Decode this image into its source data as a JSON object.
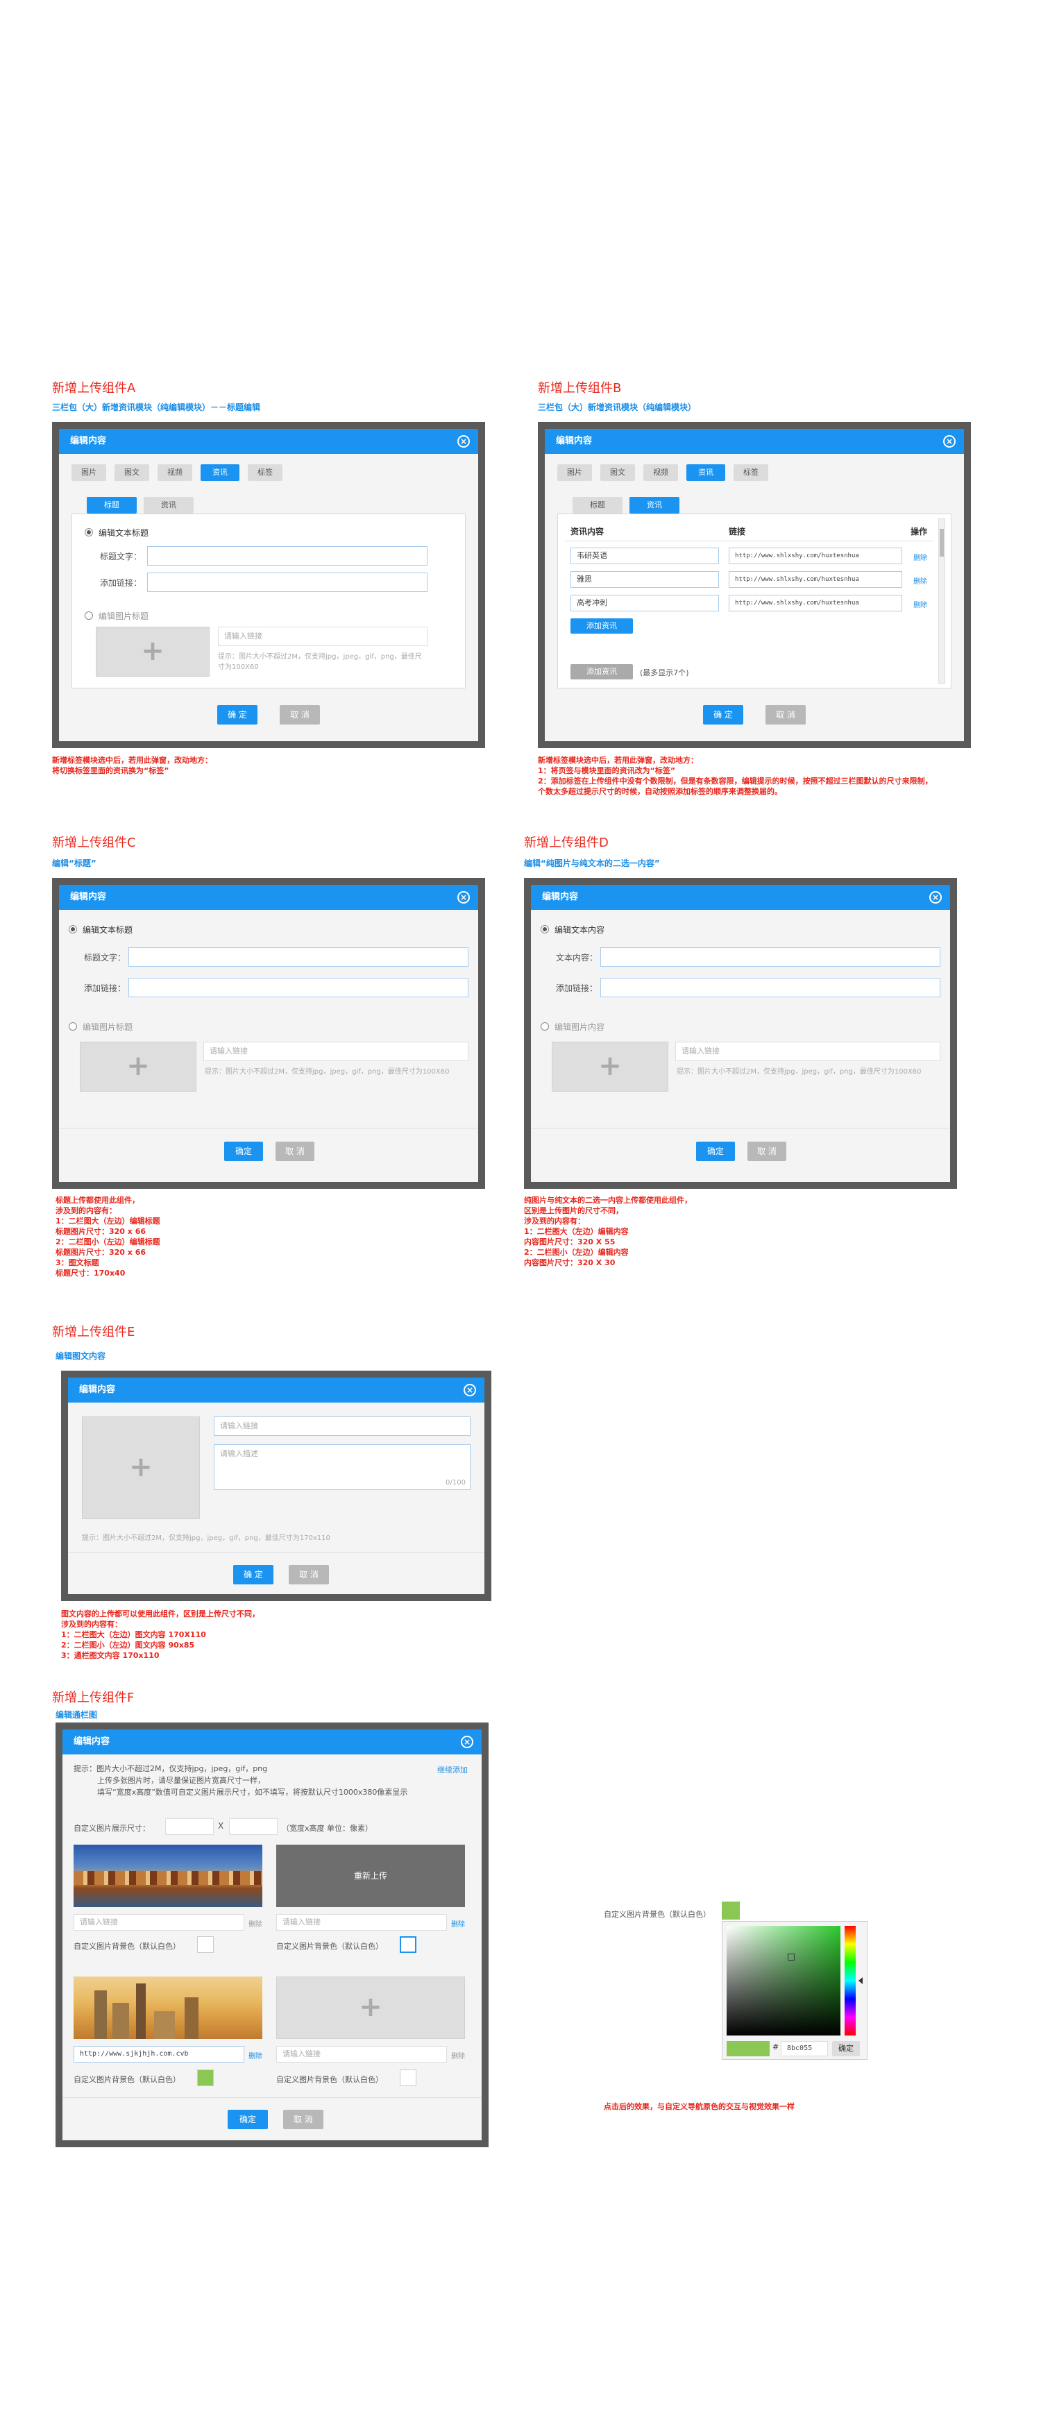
{
  "common": {
    "dialog_title": "编辑内容",
    "ok": "确 定",
    "cancel": "取 消",
    "ok_short": "确定",
    "cancel_short": "取 消"
  },
  "A": {
    "title": "新增上传组件A",
    "subtitle": "三栏包（大）新增资讯模块（纯编辑模块）－－标题编辑",
    "top_tabs": [
      "图片",
      "图文",
      "视频",
      "资讯",
      "标签"
    ],
    "sub_tabs": [
      "标题",
      "资讯"
    ],
    "text_radio": "编辑文本标题",
    "title_label": "标题文字：",
    "link_label": "添加链接：",
    "img_radio": "编辑图片标题",
    "link_placeholder": "请输入链接",
    "hint": "提示：图片大小不超过2M，仅支持jpg，jpeg，gif，png，最佳尺寸为100X60",
    "notes": [
      "新增标签模块选中后，若用此弹窗，改动地方：",
      "将切换标签里面的资讯换为“标签”"
    ]
  },
  "B": {
    "title": "新增上传组件B",
    "subtitle": "三栏包（大）新增资讯模块（纯编辑模块）",
    "top_tabs": [
      "图片",
      "图文",
      "视频",
      "资讯",
      "标签"
    ],
    "sub_tabs": [
      "标题",
      "资讯"
    ],
    "col_content": "资讯内容",
    "col_link": "链接",
    "col_op": "操作",
    "rows": [
      {
        "content": "韦研英语",
        "link": "http://www.shlxshy.com/huxtesnhua",
        "op": "删除"
      },
      {
        "content": "雅思",
        "link": "http://www.shlxshy.com/huxtesnhua",
        "op": "删除"
      },
      {
        "content": "高考冲刺",
        "link": "http://www.shlxshy.com/huxtesnhua",
        "op": "删除"
      }
    ],
    "add_label": "添加资讯",
    "add_label_disabled": "添加资讯",
    "max_note": "(最多显示7个)",
    "notes": [
      "新增标签模块选中后，若用此弹窗，改动地方：",
      "1：将页签与模块里面的资讯改为“标签”",
      "2：添加标签在上传组件中没有个数限制，但是有条数容限，编辑提示的时候，按照不超过三栏图默认的尺寸来限制，",
      "个数太多超过提示尺寸的时候，自动按照添加标签的顺序来调整换届的。"
    ]
  },
  "C": {
    "title": "新增上传组件C",
    "subtitle": "编辑“标题”",
    "text_radio": "编辑文本标题",
    "title_label": "标题文字：",
    "link_label": "添加链接：",
    "img_radio": "编辑图片标题",
    "link_placeholder": "请输入链接",
    "hint": "提示：图片大小不超过2M，仅支持jpg，jpeg，gif，png，最佳尺寸为100X60",
    "ok": "确定",
    "notes": [
      "标题上传都使用此组件，",
      "涉及到的内容有：",
      "1：二栏图大（左边）编辑标题",
      "标题图片尺寸：320 x 66",
      "2：二栏图小（左边）编辑标题",
      "标题图片尺寸：320 x 66",
      "3：图文标题",
      "标题尺寸：170x40"
    ]
  },
  "D": {
    "title": "新增上传组件D",
    "subtitle": "编辑“纯图片与纯文本的二选一内容”",
    "text_radio": "编辑文本内容",
    "text_label": "文本内容：",
    "link_label": "添加链接：",
    "img_radio": "编辑图片内容",
    "link_placeholder": "请输入链接",
    "hint": "提示：图片大小不超过2M，仅支持jpg，jpeg，gif，png，最佳尺寸为100X60",
    "ok": "确定",
    "notes": [
      "纯图片与纯文本的二选一内容上传都使用此组件，",
      "区别是上传图片的尺寸不同，",
      "涉及到的内容有：",
      "1：二栏图大（左边）编辑内容",
      "内容图片尺寸：320 X 55",
      "2：二栏图小（左边）编辑内容",
      "内容图片尺寸：320 X 30"
    ]
  },
  "E": {
    "title": "新增上传组件E",
    "subtitle": "编辑图文内容",
    "link_placeholder": "请输入链接",
    "desc_placeholder": "请输入描述",
    "counter": "0/100",
    "hint": "提示：图片大小不超过2M，仅支持jpg，jpeg，gif，png，最佳尺寸为170x110",
    "notes": [
      "图文内容的上传都可以使用此组件，区别是上传尺寸不同，",
      "涉及到的内容有：",
      "1：二栏图大（左边）图文内容  170X110",
      "2：二栏图小（左边）图文内容  90x85",
      "3：通栏图文内容  170x110"
    ]
  },
  "F": {
    "title": "新增上传组件F",
    "subtitle": "编辑通栏图",
    "hint_line1": "提示：图片大小不超过2M，仅支持jpg，jpeg，gif，png",
    "hint_line2": "上传多张图片时，请尽量保证图片宽高尺寸一样，",
    "hint_line3": "填写“宽度x高度”数值可自定义图片展示尺寸，如不填写，将按默认尺寸1000x380像素显示",
    "continue_add": "继续添加",
    "size_label": "自定义图片展示尺寸：",
    "times": "X",
    "size_unit": "（宽度x高度    单位：像素）",
    "reupload": "重新上传",
    "link_placeholder": "请输入链接",
    "delete": "删除",
    "bg_label": "自定义图片背景色（默认白色）",
    "filled_link": "http://www.sjkjhjh.com.cvb",
    "swatch_green": "#8bc755",
    "swatch_white": "#ffffff",
    "picker_label": "自定义图片背景色（默认白色）",
    "hash": "#",
    "hex": "8bc055",
    "confirm": "确定",
    "picker_note": "点击后的效果，与自定义导航原色的交互与视觉效果一样"
  }
}
